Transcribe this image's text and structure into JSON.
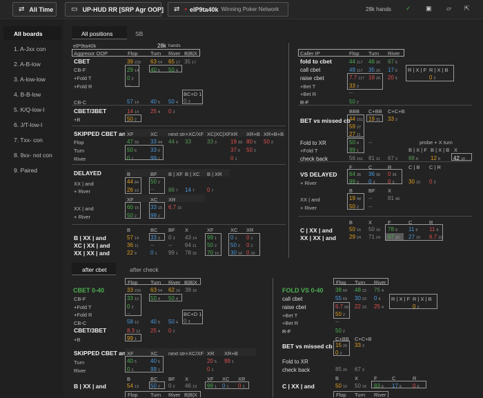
{
  "toolbar": {
    "all_time": "All Time",
    "report": "UP-HUD RR [SRP Agr OOP]",
    "player": "elP9ta40k",
    "network": "Winning Poker Network",
    "hands": "28k hands"
  },
  "sidebar": {
    "items": [
      {
        "label": "All boards",
        "active": true
      },
      {
        "label": "1. A-Jxx con"
      },
      {
        "label": "2. A-B-low"
      },
      {
        "label": "3. A-low-low"
      },
      {
        "label": "4. B-B-low"
      },
      {
        "label": "5. K/Q-low-l"
      },
      {
        "label": "6. J/T-low-l"
      },
      {
        "label": "7. Txx- con"
      },
      {
        "label": "8. 9xx- not con"
      },
      {
        "label": "9. Paired"
      }
    ]
  },
  "tabs": {
    "all_positions": "All positions",
    "sb": "SB"
  },
  "left": {
    "player": "elP9ta40k",
    "hands_count": "28k",
    "hands_label": "hands",
    "role": "Aggresor OOP",
    "col_flop": "Flop",
    "col_turn": "Turn",
    "col_river": "River",
    "col_bbx": "B|B|X",
    "cbet": "CBET",
    "cbet_flop": "39",
    "cbet_flop_n": "233",
    "cbet_turn": "63",
    "cbet_turn_n": "54",
    "cbet_river": "65",
    "cbet_river_n": "17",
    "cbet_bbx": "35",
    "cbet_bbx_n": "17",
    "cbf": "CB-F",
    "cbf_flop": "29",
    "cbf_flop_n": "14",
    "cbf_turn": "40",
    "cbf_turn_n": "5",
    "cbf_river": "50",
    "cbf_river_n": "4",
    "fold_t": "+Fold T",
    "fold_t_v": "0",
    "fold_t_n": "2",
    "fold_r": "+Fold R",
    "fold_r_v": "--",
    "bcd": "BC+D 1",
    "bcd_v": "0",
    "bcd_n": "3",
    "cbc": "CB-C",
    "cbc_flop": "57",
    "cbc_flop_n": "14",
    "cbc_turn": "40",
    "cbc_turn_n": "5",
    "cbc_river": "50",
    "cbc_river_n": "4",
    "cbet3": "CBET/3BET",
    "cbet3_flop": "14",
    "cbet3_flop_n": "14",
    "cbet3_turn": "25",
    "cbet3_turn_n": "4",
    "cbet3_river": "0",
    "cbet3_river_n": "2",
    "b_plus": "+B",
    "b_plus_v": "50",
    "b_plus_n": "2",
    "skipped": "SKIPPED CBET and",
    "sk_xf": "XF",
    "sk_xc": "XC",
    "sk_next": "next str+XC/XF",
    "sk_xcxc": "XC|XC|XF",
    "sk_xr": "XR",
    "sk_xrb": "XR+B",
    "sk_xrbb": "XR+B+B",
    "sk_flop": "Flop",
    "sk_turn": "Turn",
    "sk_river": "River",
    "sk_f": [
      "47",
      "59",
      "33",
      "44",
      "44",
      "9",
      "33",
      "3",
      "19",
      "33",
      "80",
      "5",
      "50",
      "2"
    ],
    "sk_t": [
      "50",
      "6",
      "33",
      "6",
      "37",
      "6",
      "50",
      "2"
    ],
    "sk_r": [
      "0",
      "1",
      "99",
      "1",
      "0",
      "1"
    ],
    "delayed": "DELAYED",
    "d_b": "B",
    "d_bf": "BF",
    "d_bxf": "B | XF",
    "d_bxc": "B | XC",
    "d_bxr": "B | XR",
    "d_xx": "XX | and",
    "d_xx_b": "44",
    "d_xx_b_n": "84",
    "d_xx_bf": "50",
    "d_xx_bf_n": "2",
    "d_river": "+ River",
    "d_river_b": "26",
    "d_river_b_n": "19",
    "d_river_bf": "--",
    "d_r_bxf": "86",
    "d_r_bxf_n": "7",
    "d_r_bxc": "14",
    "d_r_bxc_n": "7",
    "d_r_bxr": "0",
    "d_r_bxr_n": "7",
    "d2_xf": "XF",
    "d2_xc": "XC",
    "d2_xr": "XR",
    "d2_xx": "XX | and",
    "d2_xx_xf": "60",
    "d2_xx_xf_n": "15",
    "d2_xx_xc": "33",
    "d2_xx_xc_n": "15",
    "d2_xx_xr": "6.7",
    "d2_xx_xr_n": "15",
    "d2_river": "+ River",
    "d2_river_v": "50",
    "d2_river_n": "2",
    "d2_river_xc": "99",
    "d2_river_xc_n": "2",
    "bx_b": "B",
    "bx_bc": "BC",
    "bx_bf": "BF",
    "bx_x": "X",
    "bx_xf": "XF",
    "bx_xc": "XC",
    "bx_xr": "XR",
    "bx1": "B | XX | and",
    "bx1_v": [
      "57",
      "14",
      "33",
      "3",
      "0",
      "3",
      "43",
      "14",
      "99",
      "1",
      "0",
      "1",
      "0",
      "1"
    ],
    "bx2": "XC | XX | and",
    "bx2_v": [
      "36",
      "11",
      "--",
      "--",
      "64",
      "11",
      "50",
      "2",
      "50",
      "2",
      "0",
      "2"
    ],
    "bx3": "XX | XX | and",
    "bx3_v": [
      "22",
      "9",
      "0",
      "1",
      "99",
      "1",
      "78",
      "32",
      "70",
      "10",
      "30",
      "10",
      "0",
      "10"
    ]
  },
  "right": {
    "role": "Caller IP",
    "col_flop": "Flop",
    "col_turn": "Turn",
    "col_river": "River",
    "fold": "fold to cbet",
    "fold_flop": "44",
    "fold_flop_n": "117",
    "fold_turn": "46",
    "fold_turn_n": "26",
    "fold_river": "67",
    "fold_river_n": "6",
    "call": "call cbet",
    "call_flop": "49",
    "call_flop_n": "117",
    "call_turn": "35",
    "call_turn_n": "26",
    "call_river": "17",
    "call_river_n": "6",
    "rxf": "R | X | F",
    "rxb": "R | X | B",
    "rxb_v": "0",
    "rxb_n": "2",
    "raise": "raise cbet",
    "raise_flop": "7.7",
    "raise_flop_n": "117",
    "raise_turn": "19",
    "raise_turn_n": "26",
    "raise_river": "20",
    "raise_river_n": "5",
    "bet_t": "+Bet T",
    "bet_t_v": "33",
    "bet_t_n": "3",
    "bet_r": "+Bet R",
    "bet_r_v": "--",
    "rf": "R-F",
    "rf_v": "50",
    "rf_n": "2",
    "bvm": "BET vs missed cb",
    "bvm_bbb": "BBB",
    "bvm_cbb": "C+BB",
    "bvm_ccb": "C+C+B",
    "bvm_v": [
      "44",
      "151",
      "19",
      "31",
      "33",
      "3",
      "59",
      "37",
      "27",
      "11"
    ],
    "fxr": "Fold to XR",
    "fxr_v": "50",
    "fxr_n": "4",
    "fxr_t": "+Fold T",
    "fxr_t_v": "99",
    "fxr_t_n": "1",
    "probe": "probe + X turn",
    "probe_h": "B | X | F",
    "probe_h2": "B | X | B",
    "checkback": "check back",
    "cb_v": [
      "56",
      "161",
      "81",
      "31",
      "67",
      "3",
      "88",
      "8",
      "12",
      "8",
      "42",
      "38"
    ],
    "vsd": "VS DELAYED",
    "vsd_f": "F",
    "vsd_c": "C",
    "vsd_r": "R",
    "vsd_cb": "C | B",
    "vsd_cr": "C | R",
    "vsd_xx": "XX | and",
    "vsd_xx_v": [
      "64",
      "36",
      "36",
      "36",
      "0",
      "36",
      "30",
      "10",
      "0",
      "3"
    ],
    "vsd_river": "+ River",
    "vsd_river_v": [
      "99",
      "3",
      "0",
      "3",
      "0",
      "3"
    ],
    "v2_b": "B",
    "v2_bf": "BF",
    "v2_x": "X",
    "v2_xx": "XX | and",
    "v2_xx_v": [
      "19",
      "48",
      "--",
      "81",
      "48"
    ],
    "v2_river": "+ River",
    "v2_river_v": [
      "50",
      "2",
      "--"
    ],
    "c_h": [
      "B",
      "X",
      "F",
      "C",
      "R"
    ],
    "c1": "C | XX | and",
    "c1_v": [
      "50",
      "16",
      "50",
      "16",
      "78",
      "9",
      "11",
      "9",
      "11",
      "9"
    ],
    "c2": "XX | XX | and",
    "c2_v": [
      "29",
      "24",
      "71",
      "24",
      "67",
      "15",
      "27",
      "15",
      "6.7",
      "15"
    ]
  },
  "subtabs": {
    "after_cbet": "after cbet",
    "after_check": "after check"
  },
  "bottom_left": {
    "title": "CBET 0-40",
    "col_flop": "Flop",
    "col_turn": "Turn",
    "col_river": "River",
    "col_bbx": "B|B|X",
    "cbet": [
      "33",
      "233",
      "63",
      "54",
      "62",
      "16",
      "38",
      "16"
    ],
    "cbf": "CB-F",
    "cbf_v": [
      "33",
      "12",
      "50",
      "4",
      "50",
      "4"
    ],
    "fold_t": "+Fold T",
    "fold_t_v": "0",
    "fold_t_n": "2",
    "fold_r": "+Fold R",
    "fold_r_v": "--",
    "bcd": "BC+D 1",
    "bcd_v": "0",
    "bcd_n": "3",
    "cbc": "CB-C",
    "cbc_v": [
      "58",
      "12",
      "40",
      "5",
      "50",
      "4"
    ],
    "cbet3": "CBET/3BET",
    "cbet3_v": [
      "8.3",
      "12",
      "25",
      "4",
      "0",
      "2"
    ],
    "b_plus": "+B",
    "b_plus_v": "99",
    "b_plus_n": "1",
    "skipped": "SKIPPED CBET and",
    "sk_xf": "XF",
    "sk_xc": "XC",
    "sk_next": "next str+XC/XF",
    "sk_xr": "XR",
    "sk_xrb": "XR+B",
    "sk_turn": "Turn",
    "sk_t": [
      "40",
      "5",
      "40",
      "5",
      "20",
      "5",
      "99",
      "1"
    ],
    "sk_river": "River",
    "sk_r": [
      "0",
      "1",
      "99",
      "1",
      "0",
      "1"
    ],
    "bx_b": "B",
    "bx_bc": "BC",
    "bx_bf": "BF",
    "bx_x": "X",
    "bx_xf": "XF",
    "bx_xc": "XC",
    "bx_xr": "XR",
    "bx1": "B | XX | and",
    "bx1_v": [
      "54",
      "13",
      "50",
      "2",
      "0",
      "2",
      "46",
      "13",
      "99",
      "1",
      "0",
      "1",
      "0",
      "1"
    ],
    "foot": [
      "Flop",
      "Turn",
      "River",
      "B|B|X"
    ]
  },
  "bottom_right": {
    "title": "FOLD VS 0-40",
    "col_flop": "Flop",
    "col_turn": "Turn",
    "col_river": "River",
    "call": "call cbet",
    "call_v": [
      "38",
      "69",
      "48",
      "23",
      "75",
      "4"
    ],
    "fold_v": [
      "55",
      "69",
      "30",
      "23",
      "0",
      "4"
    ],
    "rxf": "R | X | F",
    "rxb": "R | X | B",
    "rxb_v": "0",
    "rxb_n": "2",
    "raise": "raise cbet",
    "raise_v": [
      "6.7",
      "69",
      "22",
      "23",
      "25",
      "4"
    ],
    "bet_t": "+Bet T",
    "bet_t_v": "50",
    "bet_t_n": "2",
    "bet_r": "+Bet R",
    "bet_r_v": "--",
    "rf": "R-F",
    "rf_v": "50",
    "rf_n": "2",
    "bvm": "BET vs missed cb",
    "bvm_cbb": "C+BB",
    "bvm_ccb": "C+C+B",
    "bvm_v": [
      "15",
      "26",
      "33",
      "3",
      "0",
      "2"
    ],
    "fxr": "Fold to XR",
    "checkback": "check back",
    "cb_v": [
      "85",
      "26",
      "67",
      "3"
    ],
    "c_h": [
      "B",
      "X",
      "F",
      "C",
      "R"
    ],
    "c1": "C | XX | and",
    "c1_v": [
      "50",
      "16",
      "50",
      "16",
      "83",
      "6",
      "17",
      "6",
      "0",
      "6"
    ],
    "foot": [
      "Flop",
      "Turn",
      "River"
    ]
  }
}
